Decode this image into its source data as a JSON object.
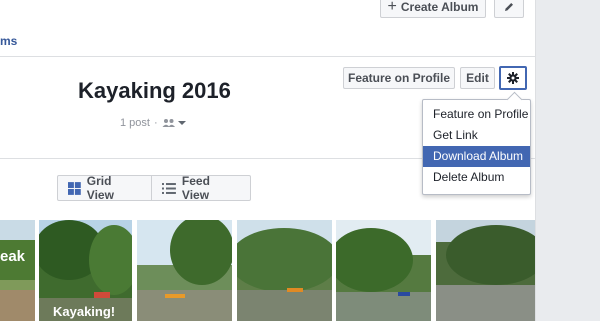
{
  "header": {
    "create_album_label": "Create Album",
    "tab_fragment": "ms"
  },
  "album": {
    "title": "Kayaking 2016",
    "post_count": "1 post",
    "separator": "·"
  },
  "actions": {
    "feature_label": "Feature on Profile",
    "edit_label": "Edit"
  },
  "dropdown": {
    "items": [
      {
        "label": "Feature on Profile"
      },
      {
        "label": "Get Link"
      },
      {
        "label": "Download Album"
      },
      {
        "label": "Delete Album"
      }
    ],
    "active_index": 2
  },
  "view_toggle": {
    "grid_label": "Grid View",
    "feed_label": "Feed View"
  },
  "photos": {
    "overlay_1": "eak",
    "overlay_2": "Kayaking!"
  },
  "icons": {
    "create": "plus-icon",
    "edit": "pencil-icon",
    "options": "gear-icon",
    "audience": "friends-icon",
    "grid": "grid-icon",
    "feed": "list-icon"
  },
  "colors": {
    "accent": "#4267b2",
    "link": "#365899",
    "muted": "#90949c",
    "page_bg": "#e9ebee"
  }
}
